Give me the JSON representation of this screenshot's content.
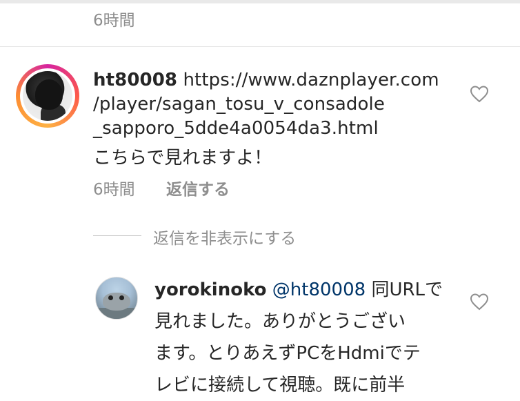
{
  "previous_comment": {
    "time": "6時間"
  },
  "comment": {
    "username": "ht80008",
    "text_lines": [
      "https://www.daznplayer.com",
      "/player/sagan_tosu_v_consadole",
      "_sapporo_5dde4a0054da3.html"
    ],
    "body": "こちらで見れますよ！",
    "time": "6時間",
    "reply_label": "返信する",
    "like_icon": "heart-outline-icon"
  },
  "replies_toggle": {
    "label": "返信を非表示にする"
  },
  "reply": {
    "username": "yorokinoko",
    "mention": "@ht80008",
    "first_line_rest": "同URLで",
    "lines": [
      "見れました。ありがとうござい",
      "ます。とりあえずPCをHdmiでテ",
      "レビに接続して視聴。既に前半"
    ],
    "like_icon": "heart-outline-icon"
  },
  "colors": {
    "text": "#262626",
    "secondary": "#8e8e8e",
    "mention": "#003569"
  }
}
